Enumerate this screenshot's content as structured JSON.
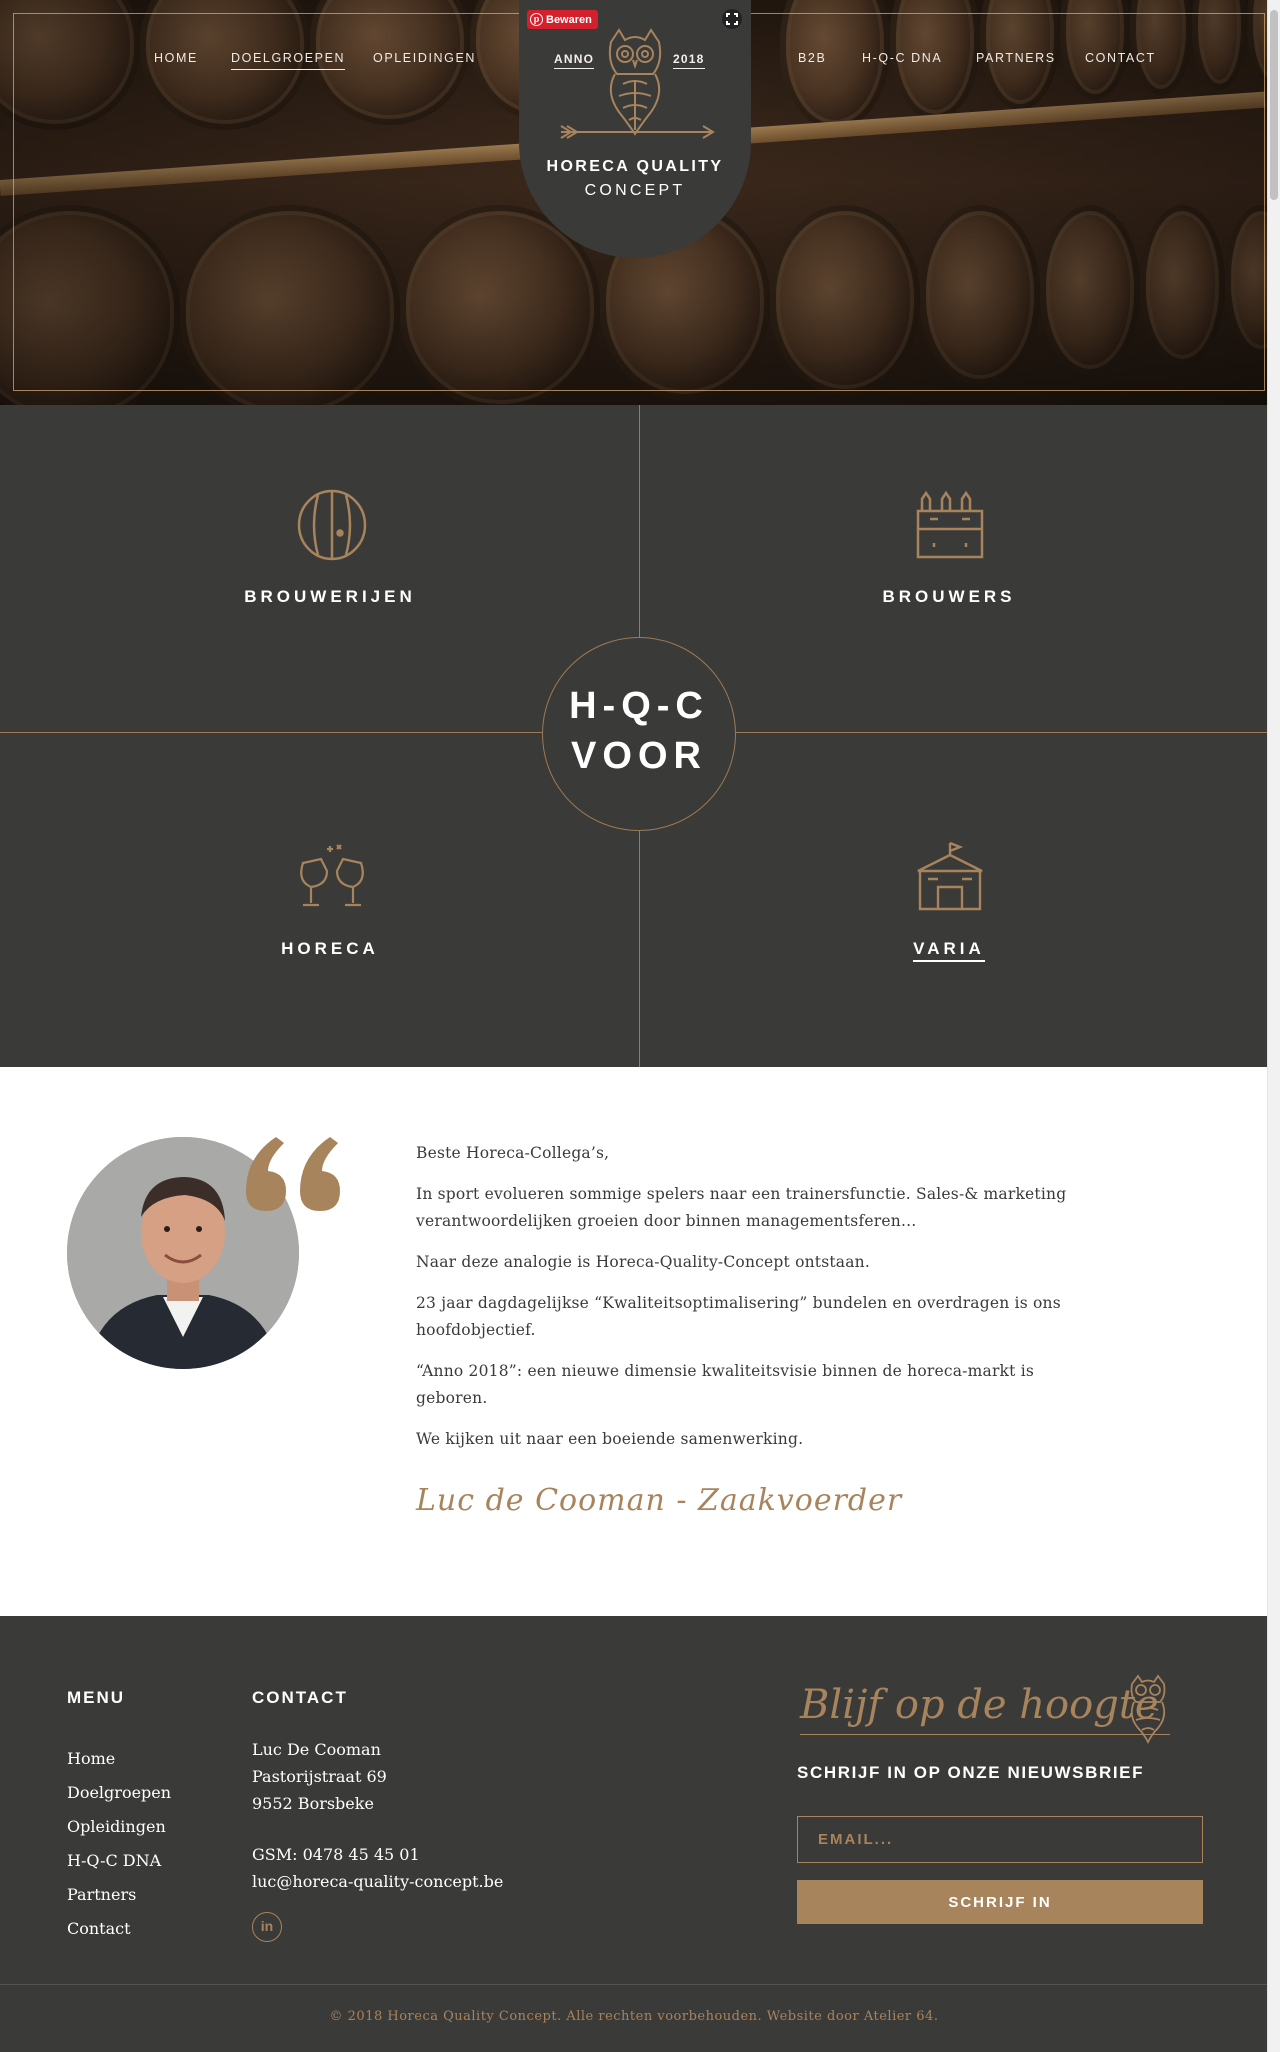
{
  "colors": {
    "accent": "#a8845c",
    "dark_bg": "#3a3a39",
    "pin_red": "#d4202c"
  },
  "header": {
    "nav_left": [
      "HOME",
      "DOELGROEPEN",
      "OPLEIDINGEN"
    ],
    "nav_right": [
      "B2B",
      "H-Q-C DNA",
      "PARTNERS",
      "CONTACT"
    ],
    "active_nav": "DOELGROEPEN",
    "logo": {
      "anno": "ANNO",
      "year": "2018",
      "line1": "HORECA QUALITY",
      "line2": "CONCEPT",
      "icon": "owl-hop-icon"
    },
    "pinterest_label": "Bewaren"
  },
  "sectors": {
    "center_line1": "H-Q-C",
    "center_line2": "VOOR",
    "items": [
      {
        "label": "BROUWERIJEN",
        "icon": "barrel-icon"
      },
      {
        "label": "BROUWERS",
        "icon": "bottle-crate-icon"
      },
      {
        "label": "HORECA",
        "icon": "toast-glasses-icon"
      },
      {
        "label": "VARIA",
        "icon": "tent-icon"
      }
    ]
  },
  "quote": {
    "paragraphs": [
      "Beste Horeca-Collega’s,",
      "In sport evolueren sommige spelers naar een trainersfunctie. Sales-& marketing verantwoordelijken groeien door binnen managementsferen…",
      "Naar deze analogie is Horeca-Quality-Concept ontstaan.",
      "23 jaar dagdagelijkse “Kwaliteitsoptimalisering” bundelen en overdragen is ons hoofdobjectief.",
      "“Anno 2018”: een nieuwe dimensie kwaliteitsvisie binnen de horeca-markt is geboren.",
      "We kijken uit naar een boeiende samenwerking."
    ],
    "signature": "Luc de Cooman - Zaakvoerder"
  },
  "footer": {
    "menu_title": "MENU",
    "menu": [
      "Home",
      "Doelgroepen",
      "Opleidingen",
      "H-Q-C DNA",
      "Partners",
      "Contact"
    ],
    "contact_title": "CONTACT",
    "contact": {
      "name": "Luc De Cooman",
      "street": "Pastorijstraat 69",
      "city": "9552 Borsbeke",
      "gsm": "GSM: 0478 45 45 01",
      "email": "luc@horeca-quality-concept.be"
    },
    "social_icon": "linkedin-icon",
    "newsletter": {
      "tagline": "Blijf op de hoogte",
      "title": "SCHRIJF IN OP ONZE NIEUWSBRIEF",
      "email_placeholder": "EMAIL...",
      "button": "SCHRIJF IN"
    },
    "copyright": "© 2018 Horeca Quality Concept. Alle rechten voorbehouden. Website door",
    "credit": "Atelier 64."
  }
}
